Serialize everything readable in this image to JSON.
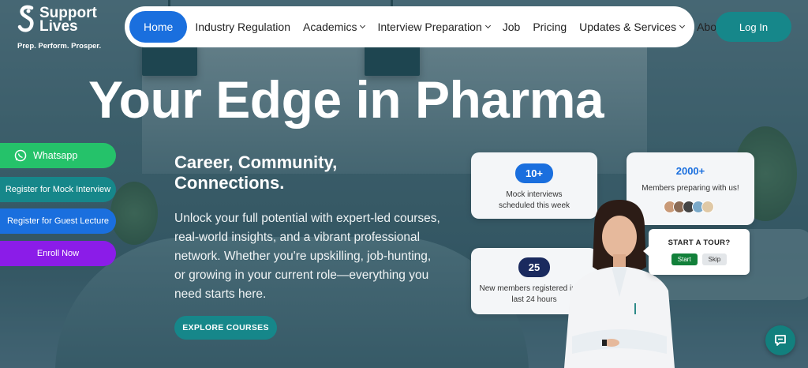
{
  "brand": {
    "name": "Support Lives",
    "tagline": "Prep. Perform. Prosper."
  },
  "nav": {
    "items": [
      {
        "label": "Home",
        "active": true,
        "dropdown": false
      },
      {
        "label": "Industry Regulation",
        "dropdown": false
      },
      {
        "label": "Academics",
        "dropdown": true
      },
      {
        "label": "Interview Preparation",
        "dropdown": true
      },
      {
        "label": "Job",
        "dropdown": false
      },
      {
        "label": "Pricing",
        "dropdown": false
      },
      {
        "label": "Updates & Services",
        "dropdown": true
      },
      {
        "label": "About Us",
        "dropdown": false
      }
    ],
    "login_label": "Log In"
  },
  "hero": {
    "title": "Your Edge in Pharma",
    "subhead": "Career, Community, Connections.",
    "description": "Unlock your full potential with expert-led courses, real-world insights, and a vibrant professional network. Whether you're upskilling, job-hunting, or growing in your current role—everything you need starts here.",
    "cta_label": "EXPLORE COURSES"
  },
  "side_buttons": {
    "whatsapp": "Whatsapp",
    "mock": "Register for Mock Interview",
    "guest": "Register for Guest Lecture",
    "enroll": "Enroll Now"
  },
  "stats": {
    "mock": {
      "value": "10+",
      "text": "Mock interviews scheduled this week"
    },
    "members": {
      "value": "2000+",
      "text": "Members preparing with us!"
    },
    "new_members": {
      "value": "25",
      "text": "New members registered in the last 24 hours"
    }
  },
  "tour": {
    "title": "START A TOUR?",
    "start": "Start",
    "skip": "Skip"
  },
  "colors": {
    "primary": "#1a6fde",
    "teal": "#16878a",
    "whatsapp": "#25c26a",
    "purple": "#8b1ce8",
    "navy": "#1a2a5e"
  },
  "icons": {
    "whatsapp": "whatsapp-icon",
    "chat": "chat-icon",
    "chevron": "chevron-down-icon"
  }
}
